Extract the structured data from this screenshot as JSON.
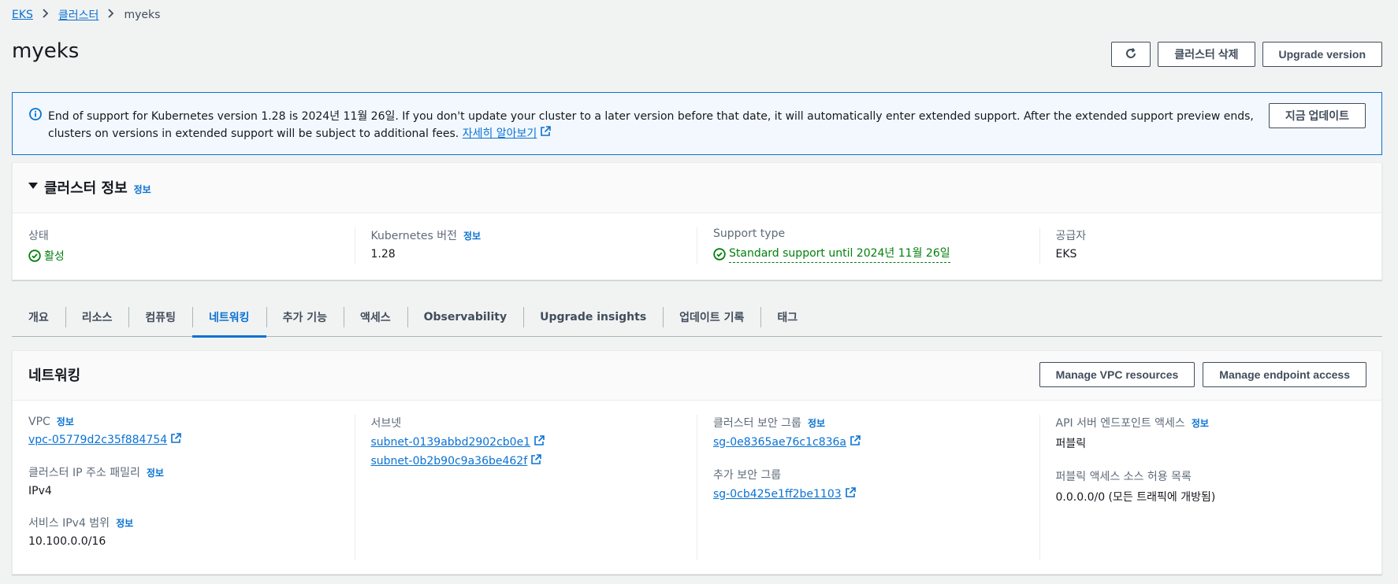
{
  "breadcrumb": {
    "items": [
      "EKS",
      "클러스터"
    ],
    "current": "myeks"
  },
  "page": {
    "title": "myeks"
  },
  "header_actions": {
    "refresh_icon": "refresh-icon",
    "delete_label": "클러스터 삭제",
    "upgrade_label": "Upgrade version"
  },
  "alert": {
    "icon": "info-icon",
    "text": "End of support for Kubernetes version 1.28 is 2024년 11월 26일. If you don't update your cluster to a later version before that date, it will automatically enter extended support. After the extended support preview ends, clusters on versions in extended support will be subject to additional fees. ",
    "link_label": "자세히 알아보기",
    "button_label": "지금 업데이트"
  },
  "cluster_info": {
    "title": "클러스터 정보",
    "info_label": "정보",
    "status_label": "상태",
    "status_value": "활성",
    "k8s_label": "Kubernetes 버전",
    "k8s_info": "정보",
    "k8s_value": "1.28",
    "support_label": "Support type",
    "support_value": "Standard support until 2024년 11월 26일",
    "provider_label": "공급자",
    "provider_value": "EKS"
  },
  "tabs": [
    "개요",
    "리소스",
    "컴퓨팅",
    "네트워킹",
    "추가 기능",
    "액세스",
    "Observability",
    "Upgrade insights",
    "업데이트 기록",
    "태그"
  ],
  "networking": {
    "title": "네트워킹",
    "manage_vpc_label": "Manage VPC resources",
    "manage_endpoint_label": "Manage endpoint access",
    "info_label": "정보",
    "vpc_label": "VPC",
    "vpc_value": "vpc-05779d2c35f884754",
    "ip_family_label": "클러스터 IP 주소 패밀리",
    "ip_family_value": "IPv4",
    "service_range_label": "서비스 IPv4 범위",
    "service_range_value": "10.100.0.0/16",
    "subnets_label": "서브넷",
    "subnets": [
      "subnet-0139abbd2902cb0e1",
      "subnet-0b2b90c9a36be462f"
    ],
    "cluster_sg_label": "클러스터 보안 그룹",
    "cluster_sg_value": "sg-0e8365ae76c1c836a",
    "extra_sg_label": "추가 보안 그룹",
    "extra_sg_value": "sg-0cb425e1ff2be1103",
    "api_access_label": "API 서버 엔드포인트 액세스",
    "api_access_value": "퍼블릭",
    "public_source_label": "퍼블릭 액세스 소스 허용 목록",
    "public_source_value": "0.0.0.0/0 (모든 트래픽에 개방됨)"
  }
}
